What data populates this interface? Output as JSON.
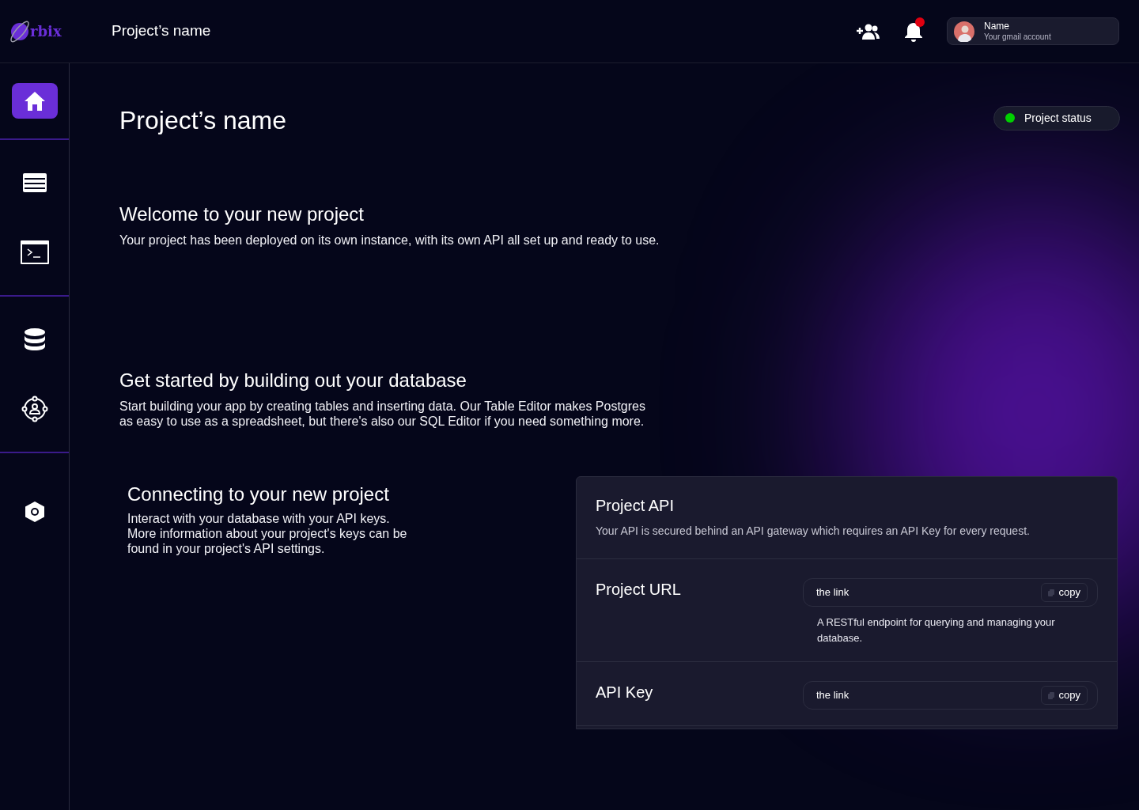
{
  "header": {
    "logo_text": "rbix",
    "project_name": "Project’s name",
    "notification_unread": true,
    "account": {
      "name": "Name",
      "email": "Your gmail account"
    }
  },
  "sidebar": {
    "groups": [
      [
        {
          "kind": "home",
          "selected": true
        }
      ],
      [
        {
          "kind": "table",
          "selected": false
        },
        {
          "kind": "terminal",
          "selected": false
        }
      ],
      [
        {
          "kind": "database",
          "selected": false
        },
        {
          "kind": "users",
          "selected": false
        }
      ],
      [
        {
          "kind": "settings",
          "selected": false
        }
      ]
    ]
  },
  "page": {
    "title": "Project’s name",
    "status": {
      "label": "Project status",
      "color": "#00d000"
    }
  },
  "sections": [
    {
      "heading": "Welcome to your new project",
      "lines": [
        "Your project has been deployed on its own instance, with its own API all set up and ready to use."
      ]
    },
    {
      "heading": "Get started by building out your database",
      "lines": [
        "Start building your app by creating tables and inserting data. Our Table Editor makes Postgres",
        "as easy to use as a spreadsheet, but there's also our SQL Editor if you need something more."
      ]
    }
  ],
  "connecting": {
    "heading": "Connecting to your new project",
    "lines": [
      "Interact with your database with your API keys.",
      "More information about your project's keys can be",
      "found in your project's API settings."
    ]
  },
  "api_card": {
    "title": "Project API",
    "description": "Your API is secured behind an API gateway which requires an API Key for every request.",
    "rows": [
      {
        "label": "Project URL",
        "value": "the link",
        "button": "copy",
        "note": "A RESTful endpoint for querying and managing your database."
      },
      {
        "label": "API Key",
        "value": "the link",
        "button": "copy"
      }
    ]
  }
}
